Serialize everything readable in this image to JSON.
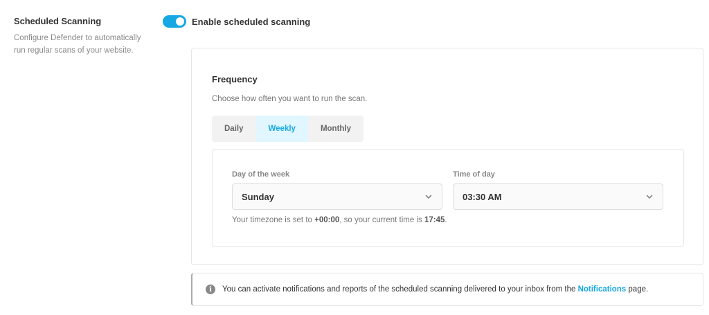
{
  "section": {
    "title": "Scheduled Scanning",
    "description": "Configure Defender to automatically run regular scans of your website."
  },
  "toggle": {
    "label": "Enable scheduled scanning",
    "enabled": true,
    "color": "#17a8e3"
  },
  "frequency": {
    "title": "Frequency",
    "description": "Choose how often you want to run the scan.",
    "tabs": [
      {
        "label": "Daily",
        "active": false
      },
      {
        "label": "Weekly",
        "active": true
      },
      {
        "label": "Monthly",
        "active": false
      }
    ],
    "day_field": {
      "label": "Day of the week",
      "value": "Sunday",
      "icon": "chevron-down-icon"
    },
    "time_field": {
      "label": "Time of day",
      "value": "03:30 AM",
      "icon": "chevron-down-icon"
    },
    "timezone_note": {
      "prefix": "Your timezone is set to ",
      "timezone": "+00:00",
      "middle": ", so your current time is ",
      "current_time": "17:45",
      "suffix": "."
    }
  },
  "notice": {
    "icon": "info-icon",
    "text_before": "You can activate notifications and reports of the scheduled scanning delivered to your inbox from the ",
    "link_label": "Notifications",
    "text_after": " page."
  }
}
